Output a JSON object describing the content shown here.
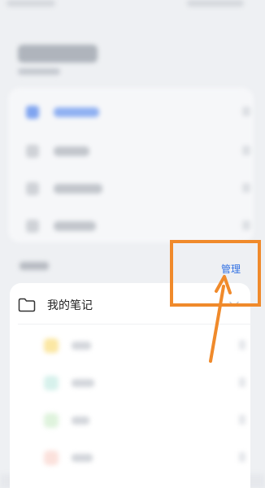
{
  "section": {
    "manage_label": "管理"
  },
  "folder": {
    "label": "我的笔记",
    "icon": "folder-icon"
  },
  "colors": {
    "accent": "#2f6fe3",
    "annotation": "#f08a2b",
    "background": "#eef0f3",
    "folder_dot_colors": [
      "#fbe7a3",
      "#d7f1ec",
      "#dff3dd",
      "#fbe1dc"
    ]
  }
}
